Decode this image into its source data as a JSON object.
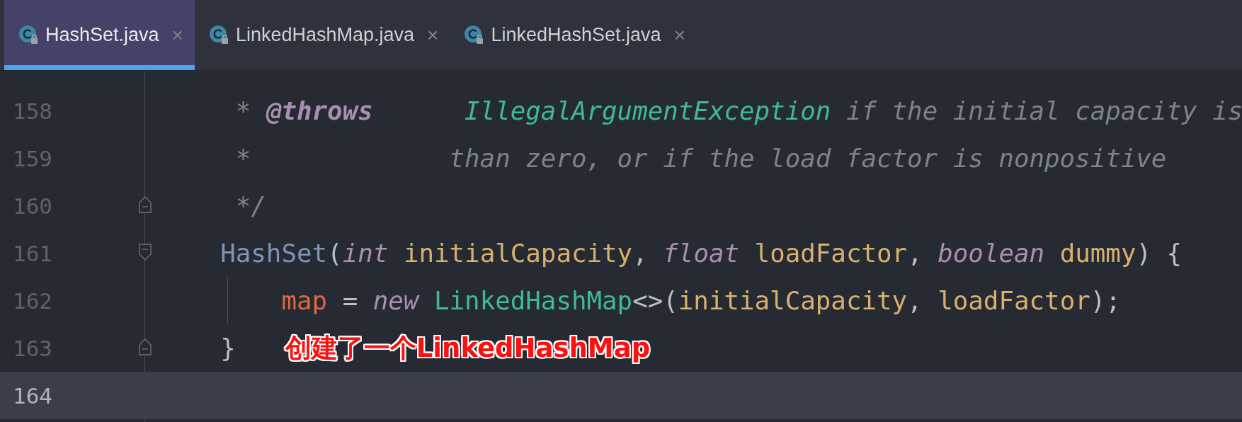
{
  "tabs": [
    {
      "label": "HashSet.java",
      "close": "×",
      "selected": true
    },
    {
      "label": "LinkedHashMap.java",
      "close": "×",
      "selected": false
    },
    {
      "label": "LinkedHashSet.java",
      "close": "×",
      "selected": false
    }
  ],
  "editor": {
    "lines": [
      {
        "number": "158",
        "current": false,
        "fold_start": false,
        "fold_end": false,
        "indent_guide": false,
        "tokens": [
          {
            "text": "     * ",
            "kind": "comment"
          },
          {
            "text": "@throws",
            "kind": "doc_tag"
          },
          {
            "text": "      IllegalArgumentException",
            "kind": "doc_ref"
          },
          {
            "text": " if the initial capacity is",
            "kind": "comment"
          }
        ]
      },
      {
        "number": "159",
        "current": false,
        "fold_start": false,
        "fold_end": false,
        "indent_guide": false,
        "tokens": [
          {
            "text": "     *",
            "kind": "comment"
          },
          {
            "text": "             than zero, or if the load factor is nonpositive",
            "kind": "comment"
          }
        ]
      },
      {
        "number": "160",
        "current": false,
        "fold_start": false,
        "fold_end": true,
        "indent_guide": false,
        "tokens": [
          {
            "text": "     */",
            "kind": "comment"
          }
        ]
      },
      {
        "number": "161",
        "current": false,
        "fold_start": true,
        "fold_end": false,
        "indent_guide": false,
        "tokens": [
          {
            "text": "    HashSet",
            "kind": "ctor"
          },
          {
            "text": "(",
            "kind": "punct"
          },
          {
            "text": "int",
            "kind": "keyword"
          },
          {
            "text": " initialCapacity",
            "kind": "param"
          },
          {
            "text": ", ",
            "kind": "punct"
          },
          {
            "text": "float",
            "kind": "keyword"
          },
          {
            "text": " loadFactor",
            "kind": "param"
          },
          {
            "text": ", ",
            "kind": "punct"
          },
          {
            "text": "boolean",
            "kind": "keyword"
          },
          {
            "text": " dummy",
            "kind": "param"
          },
          {
            "text": ") {",
            "kind": "punct"
          }
        ]
      },
      {
        "number": "162",
        "current": false,
        "fold_start": false,
        "fold_end": false,
        "indent_guide": true,
        "tokens": [
          {
            "text": "        map",
            "kind": "field"
          },
          {
            "text": " = ",
            "kind": "punct"
          },
          {
            "text": "new",
            "kind": "keyword"
          },
          {
            "text": " LinkedHashMap",
            "kind": "class"
          },
          {
            "text": "<>(",
            "kind": "punct"
          },
          {
            "text": "initialCapacity",
            "kind": "param"
          },
          {
            "text": ", ",
            "kind": "punct"
          },
          {
            "text": "loadFactor",
            "kind": "param"
          },
          {
            "text": ");",
            "kind": "punct"
          }
        ]
      },
      {
        "number": "163",
        "current": false,
        "fold_start": false,
        "fold_end": true,
        "indent_guide": false,
        "tokens": [
          {
            "text": "    }",
            "kind": "punct"
          }
        ],
        "annotation": "创建了一个LinkedHashMap"
      },
      {
        "number": "164",
        "current": true,
        "fold_start": false,
        "fold_end": false,
        "indent_guide": false
      }
    ]
  }
}
